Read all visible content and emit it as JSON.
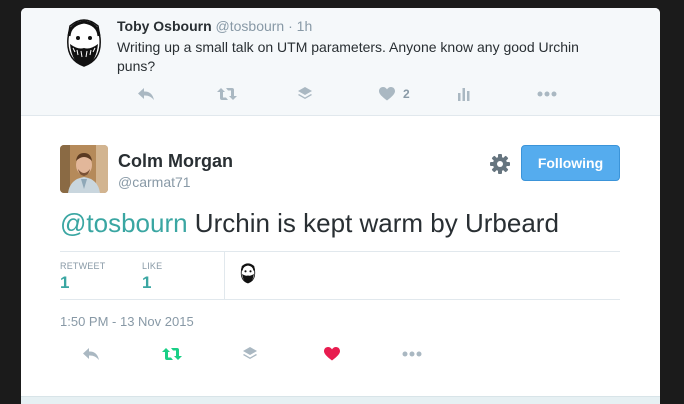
{
  "parent_tweet": {
    "name": "Toby Osbourn",
    "handle": "@tosbourn",
    "separator": "·",
    "time": "1h",
    "text": "Writing up a small talk on UTM parameters. Anyone know any good Urchin puns?",
    "like_count": "2"
  },
  "main_tweet": {
    "name": "Colm Morgan",
    "handle": "@carmat71",
    "follow_label": "Following",
    "mention": "@tosbourn",
    "text": " Urchin is kept warm by Urbeard",
    "retweet_label": "RETWEET",
    "retweet_count": "1",
    "like_label": "LIKE",
    "like_count": "1",
    "timestamp": "1:50 PM - 13 Nov 2015"
  },
  "colors": {
    "accent_teal": "#3aa6a2",
    "follow_blue": "#55acee",
    "like_red": "#e81c4f",
    "retweet_green": "#19cf86",
    "muted": "#aab8c2"
  },
  "icons": [
    "reply-icon",
    "retweet-icon",
    "layers-icon",
    "heart-icon",
    "stats-icon",
    "more-icon",
    "gear-icon"
  ]
}
